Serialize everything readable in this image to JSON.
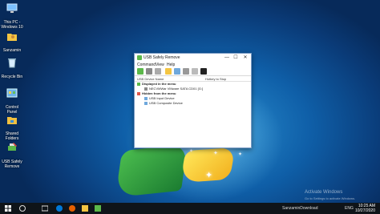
{
  "desktop": {
    "icons": [
      {
        "name": "this-pc-icon",
        "label": "This PC - Windows 10"
      },
      {
        "name": "user-folder-icon",
        "label": "Sanzamin"
      },
      {
        "name": "recycle-bin-icon",
        "label": "Recycle Bin"
      },
      {
        "name": "control-panel-icon",
        "label": "Control Panel"
      },
      {
        "name": "shared-folders-icon",
        "label": "Shared Folders"
      },
      {
        "name": "usb-safely-remove-icon",
        "label": "USB Safely Remove"
      }
    ],
    "watermark_line1": "Activate Windows",
    "watermark_line2": "Go to Settings to activate Windows."
  },
  "window": {
    "title": "USB Safely Remove",
    "controls": {
      "minimize": "—",
      "maximize": "☐",
      "close": "✕"
    },
    "menu": [
      "Command",
      "View",
      "Help"
    ],
    "columns": {
      "device": "USB Device Name",
      "hotkey": "Hotkey to Stop"
    },
    "tree": {
      "displayed_group": "Displayed in the menu",
      "displayed_items": [
        "NECVMWar VMware SATA CD01 [G:]"
      ],
      "hidden_group": "Hidden from the menu",
      "hidden_items": [
        "USB Input Device",
        "USB Composite Device"
      ]
    }
  },
  "taskbar": {
    "tray_label": "SanzaminDownload",
    "lang": "ENG",
    "time": "10:25 AM",
    "date": "10/27/2020"
  },
  "colors": {
    "accent": "#0078d7",
    "taskbar": "#0f1419",
    "usb_green": "#5bb84a"
  }
}
